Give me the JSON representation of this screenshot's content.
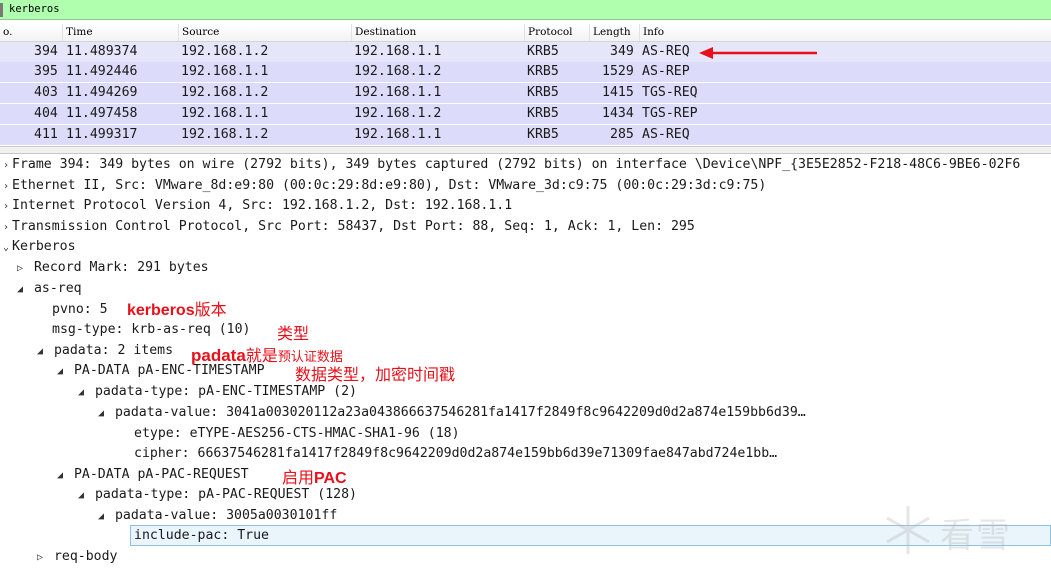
{
  "filter": {
    "text": "kerberos"
  },
  "columns": [
    {
      "key": "no",
      "label": "o."
    },
    {
      "key": "time",
      "label": "Time"
    },
    {
      "key": "source",
      "label": "Source"
    },
    {
      "key": "destination",
      "label": "Destination"
    },
    {
      "key": "protocol",
      "label": "Protocol"
    },
    {
      "key": "length",
      "label": "Length"
    },
    {
      "key": "info",
      "label": "Info"
    }
  ],
  "packets": [
    {
      "no": "394",
      "time": "11.489374",
      "source": "192.168.1.2",
      "destination": "192.168.1.1",
      "protocol": "KRB5",
      "length": "349",
      "info": "AS-REQ",
      "selected": true
    },
    {
      "no": "395",
      "time": "11.492446",
      "source": "192.168.1.1",
      "destination": "192.168.1.2",
      "protocol": "KRB5",
      "length": "1529",
      "info": "AS-REP"
    },
    {
      "no": "403",
      "time": "11.494269",
      "source": "192.168.1.2",
      "destination": "192.168.1.1",
      "protocol": "KRB5",
      "length": "1415",
      "info": "TGS-REQ"
    },
    {
      "no": "404",
      "time": "11.497458",
      "source": "192.168.1.1",
      "destination": "192.168.1.2",
      "protocol": "KRB5",
      "length": "1434",
      "info": "TGS-REP"
    },
    {
      "no": "411",
      "time": "11.499317",
      "source": "192.168.1.2",
      "destination": "192.168.1.1",
      "protocol": "KRB5",
      "length": "285",
      "info": "AS-REQ"
    }
  ],
  "tree": [
    {
      "toggle": "›",
      "text": "Frame 394: 349 bytes on wire (2792 bits), 349 bytes captured (2792 bits) on interface \\Device\\NPF_{3E5E2852-F218-48C6-9BE6-02F6"
    },
    {
      "toggle": "›",
      "text": "Ethernet II, Src: VMware_8d:e9:80 (00:0c:29:8d:e9:80), Dst: VMware_3d:c9:75 (00:0c:29:3d:c9:75)"
    },
    {
      "toggle": "›",
      "text": "Internet Protocol Version 4, Src: 192.168.1.2, Dst: 192.168.1.1"
    },
    {
      "toggle": "›",
      "text": "Transmission Control Protocol, Src Port: 58437, Dst Port: 88, Seq: 1, Ack: 1, Len: 295"
    },
    {
      "toggle": "⌄",
      "text": "Kerberos"
    },
    {
      "toggle": "▷",
      "text": "Record Mark: 291 bytes"
    },
    {
      "toggle": "◢",
      "text": "as-req"
    },
    {
      "toggle": "",
      "text": "pvno: 5"
    },
    {
      "toggle": "",
      "text": "msg-type: krb-as-req (10)"
    },
    {
      "toggle": "◢",
      "text": "padata: 2 items"
    },
    {
      "toggle": "◢",
      "text": "PA-DATA pA-ENC-TIMESTAMP"
    },
    {
      "toggle": "◢",
      "text": "padata-type: pA-ENC-TIMESTAMP (2)"
    },
    {
      "toggle": "◢",
      "text": "padata-value: 3041a003020112a23a043866637546281fa1417f2849f8c9642209d0d2a874e159bb6d39…"
    },
    {
      "toggle": "",
      "text": "etype: eTYPE-AES256-CTS-HMAC-SHA1-96 (18)"
    },
    {
      "toggle": "",
      "text": "cipher: 66637546281fa1417f2849f8c9642209d0d2a874e159bb6d39e71309fae847abd724e1bb…"
    },
    {
      "toggle": "◢",
      "text": "PA-DATA pA-PAC-REQUEST"
    },
    {
      "toggle": "◢",
      "text": "padata-type: pA-PAC-REQUEST (128)"
    },
    {
      "toggle": "◢",
      "text": "padata-value: 3005a0030101ff"
    },
    {
      "toggle": "",
      "text": "include-pac: True"
    },
    {
      "toggle": "▷",
      "text": "req-body"
    }
  ],
  "annotations": {
    "pvno_bold": "kerberos",
    "pvno_rest": "版本",
    "msgtype": "类型",
    "padata_bold": "padata",
    "padata_mid": "就是",
    "padata_small": "预认证数据",
    "timestamp": "数据类型，加密时间戳",
    "pac_prefix": "启用",
    "pac_bold": "PAC"
  },
  "watermark": {
    "text": "看雪"
  },
  "colors": {
    "filter_bg": "#afffaf",
    "row_bg": "#dcdcfa",
    "annotation": "#e8101a",
    "highlight": "#e9f4fb"
  }
}
